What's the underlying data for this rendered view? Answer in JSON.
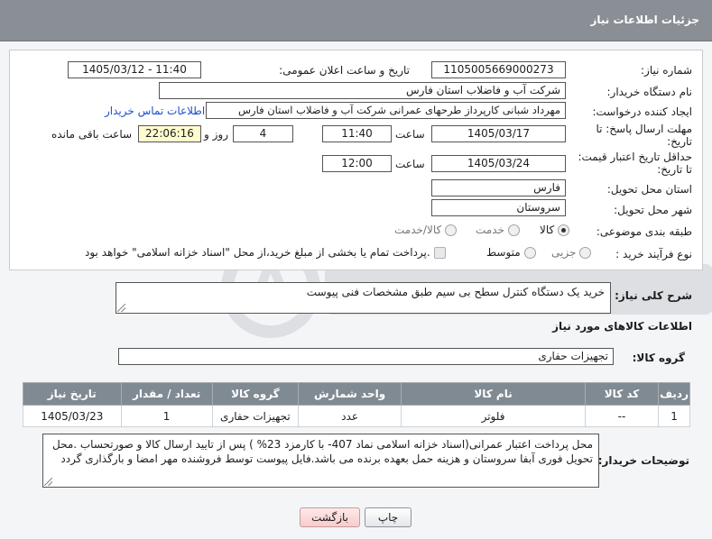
{
  "header": {
    "title": "جزئیات اطلاعات نیاز"
  },
  "form": {
    "need_number_label": "شماره نیاز:",
    "need_number": "1105005669000273",
    "announce_label": "تاریخ و ساعت اعلان عمومی:",
    "announce_value": "1405/03/12 - 11:40",
    "buyer_org_label": "نام دستگاه خریدار:",
    "buyer_org": "شرکت آب و فاضلاب استان فارس",
    "requester_label": "ایجاد کننده درخواست:",
    "requester": "مهرداد شبانی کارپرداز طرحهای عمرانی  شرکت آب و فاضلاب استان فارس",
    "contact_link": "اطلاعات تماس خریدار",
    "reply_deadline_label_1": "مهلت ارسال پاسخ: تا",
    "reply_deadline_label_2": "تاریخ:",
    "reply_date": "1405/03/17",
    "time_label": "ساعت",
    "reply_time": "11:40",
    "days_count": "4",
    "days_label": "روز و",
    "remaining_time": "22:06:16",
    "remaining_label": "ساعت باقی مانده",
    "validity_label_1": "حداقل تاریخ اعتبار قیمت:",
    "validity_label_2": "تا تاریخ:",
    "validity_date": "1405/03/24",
    "validity_time": "12:00",
    "province_label": "استان محل تحویل:",
    "province": "فارس",
    "city_label": "شهر محل تحویل:",
    "city": "سروستان",
    "category_label": "طبقه بندی موضوعی:",
    "category_options": [
      "کالا",
      "خدمت",
      "کالا/خدمت"
    ],
    "category_selected": "کالا",
    "process_label": "نوع فرآیند خرید :",
    "process_options": [
      "جزیی",
      "متوسط"
    ],
    "process_selected": "متوسط",
    "payment_note": "پرداخت تمام یا بخشی از مبلغ خرید،از محل \"اسناد خزانه اسلامی\" خواهد بود."
  },
  "summary": {
    "label": "شرح کلی نیاز:",
    "text": "خرید یک دستگاه کنترل سطح بی سیم طبق مشخصات فنی پیوست"
  },
  "goods_section": {
    "title": "اطلاعات کالاهای مورد نیاز",
    "group_label": "گروه کالا:",
    "group_value": "تجهیزات حفاری"
  },
  "table": {
    "headers": [
      "ردیف",
      "کد کالا",
      "نام کالا",
      "واحد شمارش",
      "گروه کالا",
      "تعداد / مقدار",
      "تاریخ نیاز"
    ],
    "rows": [
      [
        "1",
        "--",
        "فلوتر",
        "عدد",
        "تجهیزات حفاری",
        "1",
        "1405/03/23"
      ]
    ]
  },
  "buyer_notes": {
    "label": "توضیحات خریدار:",
    "text": "محل پرداخت اعتبار عمرانی(اسناد خزانه اسلامی نماد 407- با کارمزد 23% ) پس از تایید ارسال کالا و صورتحساب .محل تحویل فوری آبفا سروستان   و هزینه حمل بعهده برنده می باشد.فایل پیوست توسط فروشنده مهر امضا و بارگذاری گردد"
  },
  "buttons": {
    "print": "چاپ",
    "back": "بازگشت"
  },
  "colors": {
    "header": "#8a8f96",
    "table_header": "#808a93",
    "link": "#1a4fd0",
    "highlight": "#fefccf"
  }
}
